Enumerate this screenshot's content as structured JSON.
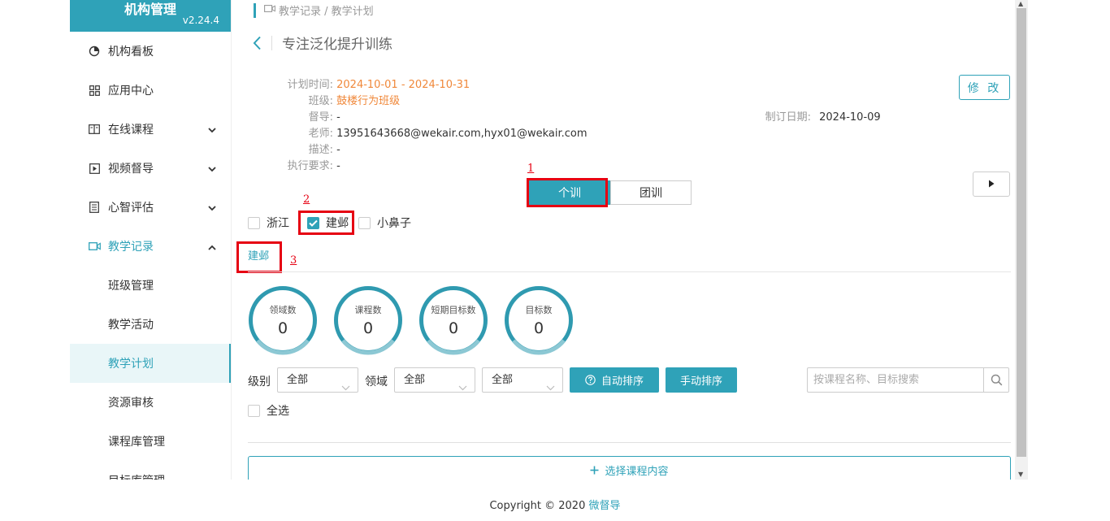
{
  "app": {
    "title": "机构管理",
    "version": "v2.24.4"
  },
  "sidebar": {
    "items": [
      {
        "label": "机构看板"
      },
      {
        "label": "应用中心"
      },
      {
        "label": "在线课程"
      },
      {
        "label": "视频督导"
      },
      {
        "label": "心智评估"
      },
      {
        "label": "教学记录"
      }
    ],
    "sub_items": [
      {
        "label": "班级管理"
      },
      {
        "label": "教学活动"
      },
      {
        "label": "教学计划"
      },
      {
        "label": "资源审核"
      },
      {
        "label": "课程库管理"
      },
      {
        "label": "目标库管理"
      }
    ]
  },
  "breadcrumb": {
    "text": "教学记录 / 教学计划"
  },
  "page": {
    "title": "专注泛化提升训练"
  },
  "plan": {
    "time_label": "计划时间:",
    "time_value": "2024-10-01 - 2024-10-31",
    "class_label": "班级:",
    "class_value": "鼓楼行为班级",
    "supervisor_label": "督导:",
    "supervisor_value": "-",
    "teacher_label": "老师:",
    "teacher_value": "13951643668@wekair.com,hyx01@wekair.com",
    "desc_label": "描述:",
    "desc_value": "-",
    "req_label": "执行要求:",
    "req_value": "-",
    "date_label": "制订日期:",
    "date_value": "2024-10-09"
  },
  "toolbar": {
    "edit_label": "修 改"
  },
  "markers": {
    "m1": "1",
    "m2": "2",
    "m3": "3"
  },
  "mode_tabs": [
    {
      "label": "个训"
    },
    {
      "label": "团训"
    }
  ],
  "students": [
    {
      "label": "浙江",
      "checked": false
    },
    {
      "label": "建邺",
      "checked": true
    },
    {
      "label": "小鼻子",
      "checked": false
    }
  ],
  "active_tab": {
    "label": "建邺"
  },
  "stats": [
    {
      "label": "领域数",
      "value": "0"
    },
    {
      "label": "课程数",
      "value": "0"
    },
    {
      "label": "短期目标数",
      "value": "0"
    },
    {
      "label": "目标数",
      "value": "0"
    }
  ],
  "filters": {
    "level_label": "级别",
    "level_value": "全部",
    "domain_label": "领域",
    "domain_value": "全部",
    "sub_value": "全部",
    "auto_sort": "自动排序",
    "manual_sort": "手动排序",
    "search_placeholder": "按课程名称、目标搜索",
    "select_all": "全选"
  },
  "actions": {
    "choose_content": "选择课程内容"
  },
  "footer": {
    "copyright": "Copyright © 2020",
    "brand": "微督导"
  },
  "colors": {
    "accent": "#2fa2b8",
    "orange": "#f0883a",
    "highlight": "#e60012"
  }
}
